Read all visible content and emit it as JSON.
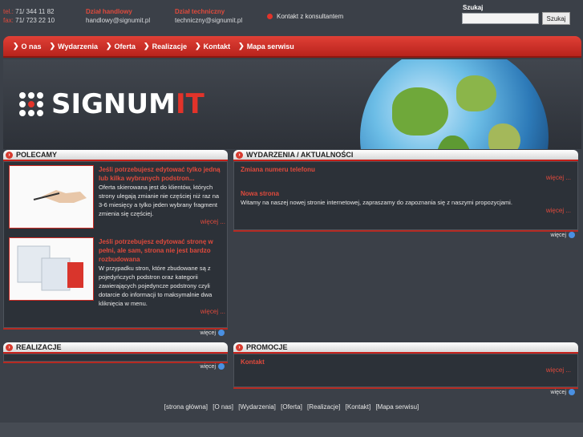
{
  "contact": {
    "tel_label": "tel.:",
    "tel": "71/ 344 11 82",
    "fax_label": "fax:",
    "fax": "71/ 723 22 10"
  },
  "sales": {
    "title": "Dział handlowy",
    "email": "handlowy@signumit.pl"
  },
  "tech": {
    "title": "Dział techniczny",
    "email": "techniczny@signumit.pl"
  },
  "consult": {
    "label": "Kontakt z konsultantem"
  },
  "search": {
    "label": "Szukaj",
    "button": "Szukaj",
    "value": ""
  },
  "nav": [
    {
      "label": "O nas"
    },
    {
      "label": "Wydarzenia"
    },
    {
      "label": "Oferta"
    },
    {
      "label": "Realizacje"
    },
    {
      "label": "Kontakt"
    },
    {
      "label": "Mapa serwisu"
    }
  ],
  "logo": {
    "text": "SIGNUM",
    "accent": "IT"
  },
  "polecamy": {
    "title": "POLECAMY",
    "items": [
      {
        "title": "Jeśli potrzebujesz edytować tylko jedną lub kilka wybranych podstron...",
        "text": "Oferta skierowana jest do klientów, których strony ulegają zmianie nie częściej niż raz na 3-6 miesięcy a tylko jeden wybrany fragment zmienia się częściej.",
        "more": "więcej ..."
      },
      {
        "title": "Jeśli potrzebujesz edytować stronę w pełni, ale sam, strona nie jest bardzo rozbudowana",
        "text": "W przypadku stron, które zbudowane są z pojedyńczych podstron oraz kategorii zawierających pojedyncze podstrony czyli dotarcie do informacji to maksymalnie dwa kliknięcia w menu.",
        "more": "więcej ..."
      }
    ],
    "footer_more": "więcej"
  },
  "wydarzenia": {
    "title": "WYDARZENIA / AKTUALNOŚCI",
    "items": [
      {
        "title": "Zmiana numeru telefonu",
        "text": "",
        "more": "więcej ..."
      },
      {
        "title": "Nowa strona",
        "text": "Witamy na naszej nowej stronie internetowej, zapraszamy do zapoznania się z naszymi propozycjami.",
        "more": "więcej ..."
      }
    ],
    "footer_more": "więcej"
  },
  "realizacje": {
    "title": "REALIZACJE",
    "footer_more": "więcej"
  },
  "promocje": {
    "title": "PROMOCJE",
    "item_title": "Kontakt",
    "more": "więcej ...",
    "footer_more": "więcej"
  },
  "footer_links": [
    "[strona główna]",
    "[O nas]",
    "[Wydarzenia]",
    "[Oferta]",
    "[Realizacje]",
    "[Kontakt]",
    "[Mapa serwisu]"
  ],
  "colors": {
    "accent": "#e04a3c",
    "nav": "#d0322a",
    "bg": "#3b4048"
  }
}
